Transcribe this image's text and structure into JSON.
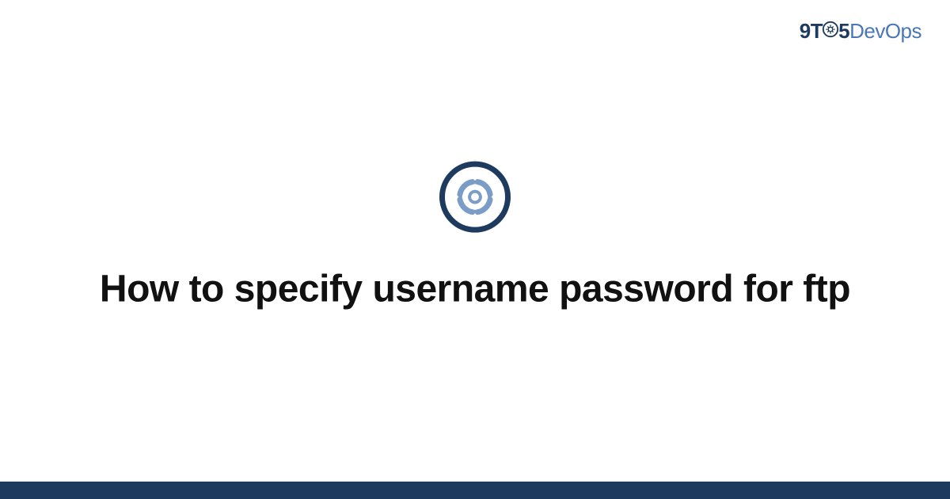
{
  "logo": {
    "nine": "9",
    "t": "T",
    "five": "5",
    "devops": "DevOps"
  },
  "title": "How to specify username password for ftp",
  "colors": {
    "dark_blue": "#1e3a5f",
    "light_blue": "#4b77b8",
    "gear_light": "#7a9cc6"
  }
}
